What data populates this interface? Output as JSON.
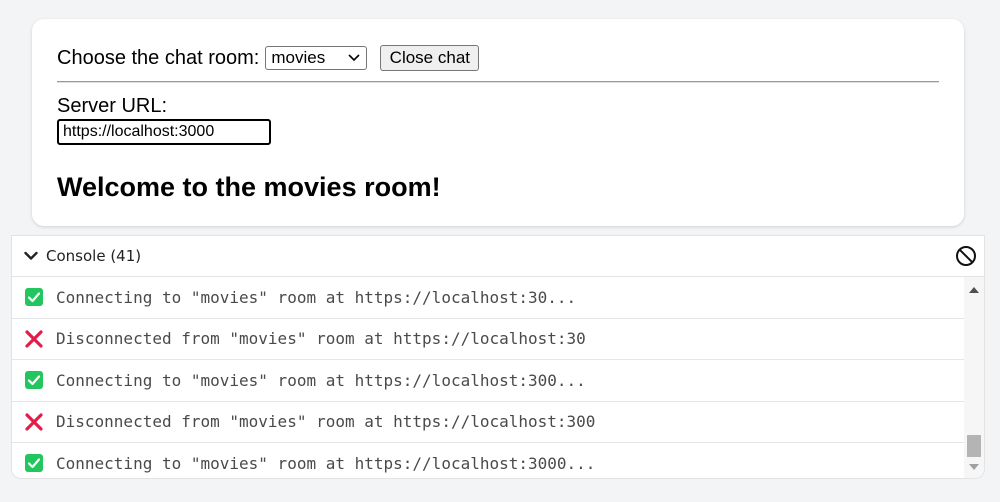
{
  "room": {
    "label": "Choose the chat room:",
    "selected": "movies",
    "close_button": "Close chat"
  },
  "server": {
    "label": "Server URL:",
    "value": "https://localhost:3000"
  },
  "welcome": "Welcome to the movies room!",
  "console": {
    "title": "Console (41)",
    "logs": [
      {
        "type": "success",
        "icon": "check-icon",
        "text": "Connecting to \"movies\" room at https://localhost:30..."
      },
      {
        "type": "error",
        "icon": "x-icon",
        "text": "Disconnected from \"movies\" room at https://localhost:30"
      },
      {
        "type": "success",
        "icon": "check-icon",
        "text": "Connecting to \"movies\" room at https://localhost:300..."
      },
      {
        "type": "error",
        "icon": "x-icon",
        "text": "Disconnected from \"movies\" room at https://localhost:300"
      },
      {
        "type": "success",
        "icon": "check-icon",
        "text": "Connecting to \"movies\" room at https://localhost:3000..."
      }
    ]
  },
  "colors": {
    "success": "#22c55e",
    "error": "#e11d48",
    "card_bg": "#ffffff",
    "page_bg": "#f3f4f6"
  }
}
